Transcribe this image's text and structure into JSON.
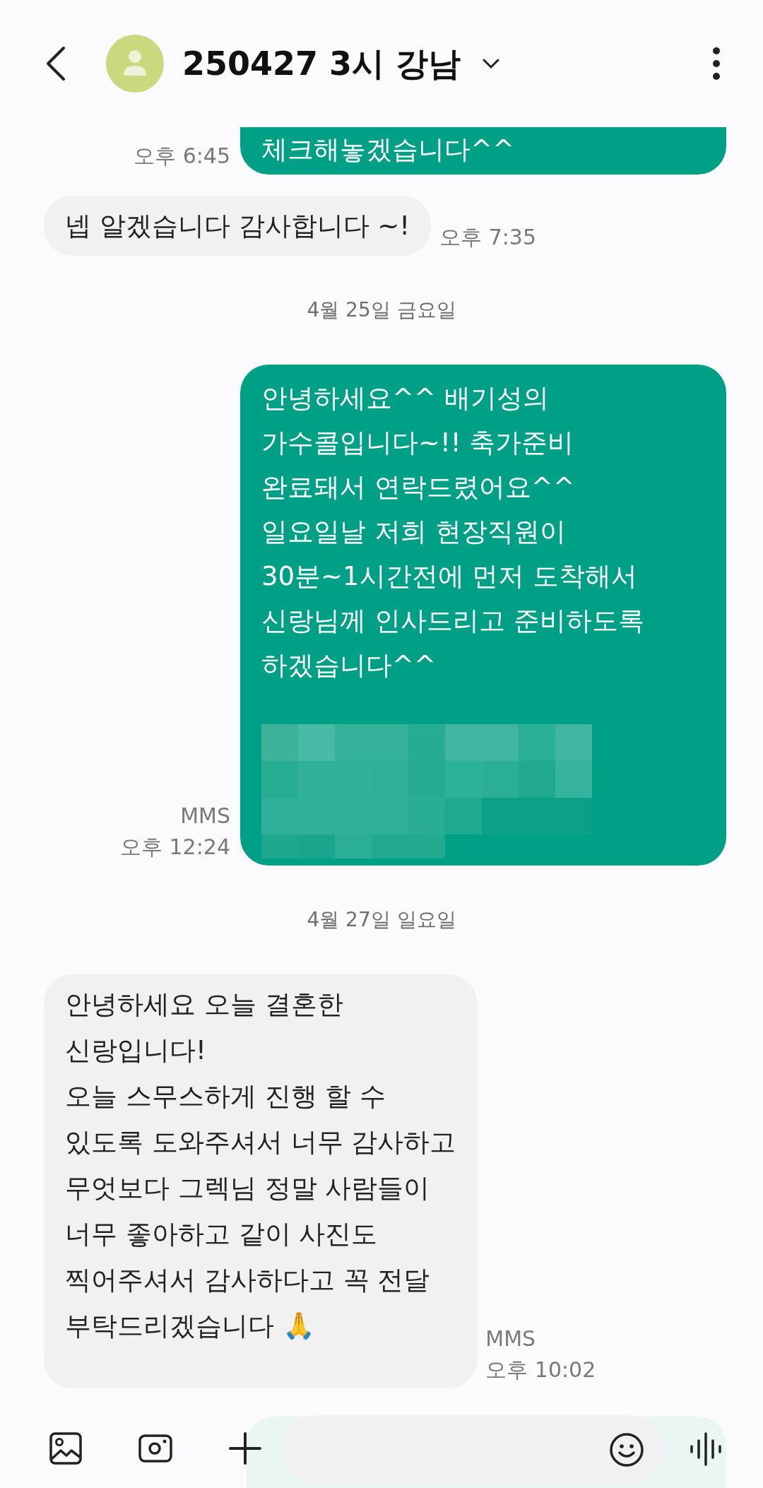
{
  "header": {
    "title": "250427 3시 강남"
  },
  "messages": [
    {
      "kind": "sent",
      "cut": true,
      "text": "체크해놓겠습니다^^",
      "time": "오후 6:45"
    },
    {
      "kind": "received",
      "text": "넵 알겠습니다 감사합니다 ~!",
      "time": "오후 7:35"
    },
    {
      "kind": "date",
      "text": "4월 25일 금요일"
    },
    {
      "kind": "sent",
      "text": "안녕하세요^^ 배기성의\n가수콜입니다~!! 축가준비\n완료돼서 연락드렸어요^^\n일요일날 저희 현장직원이\n30분~1시간전에 먼저 도착해서\n신랑님께 인사드리고 준비하도록\n하겠습니다^^",
      "tag": "MMS",
      "time": "오후 12:24"
    },
    {
      "kind": "date",
      "text": "4월 27일 일요일"
    },
    {
      "kind": "received",
      "text": "안녕하세요 오늘 결혼한\n신랑입니다!\n오늘 스무스하게 진행 할 수\n있도록 도와주셔서 너무 감사하고\n무엇보다 그렉님 정말 사람들이\n너무 좋아하고 같이 사진도\n찍어주셔서 감사하다고 꼭 전달\n부탁드리겠습니다 🙏",
      "tag": "MMS",
      "time": "오후 10:02"
    }
  ]
}
